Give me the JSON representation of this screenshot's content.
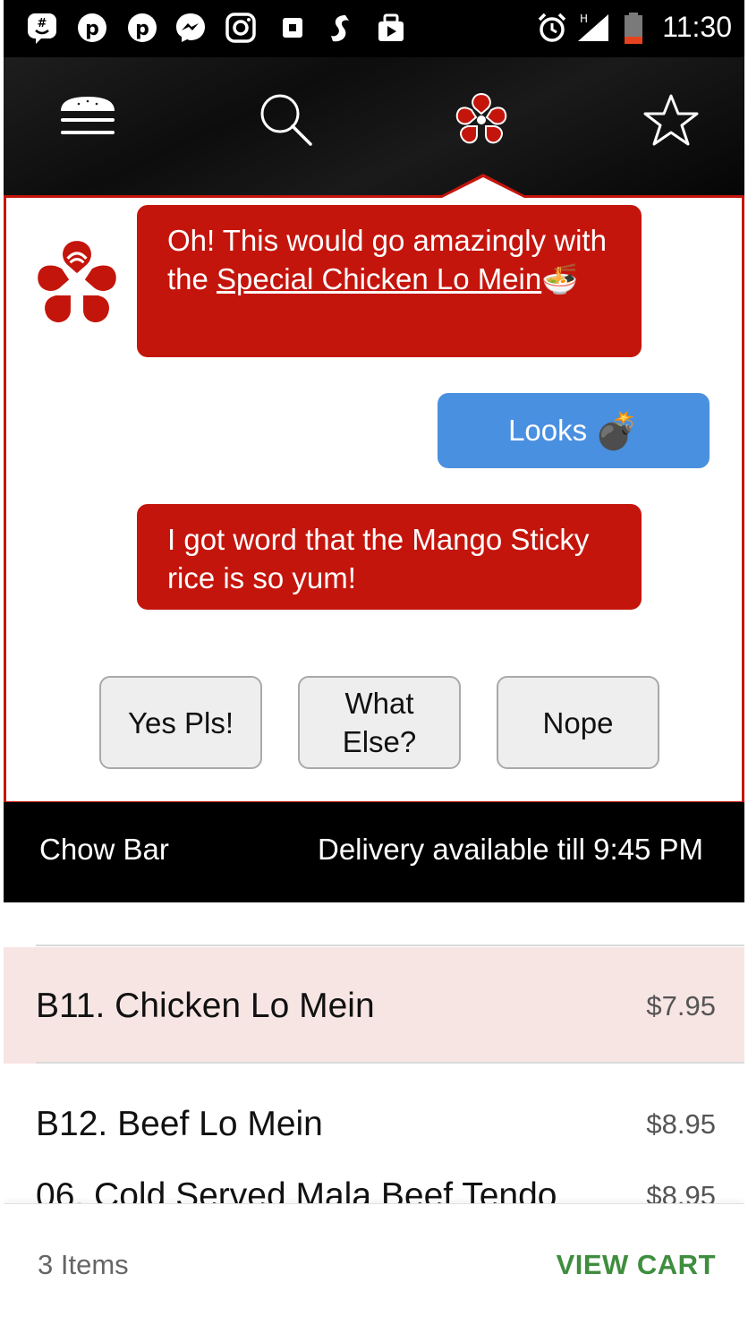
{
  "status_bar": {
    "time": "11:30",
    "network": "H",
    "left_icons": [
      "groupme-icon",
      "pinterest-icon",
      "pinterest-icon",
      "messenger-icon",
      "instagram-icon",
      "square-app-icon",
      "shazam-icon",
      "youtube-icon"
    ]
  },
  "nav": {
    "icons": [
      "menu-burger-icon",
      "search-icon",
      "chowbot-logo-icon",
      "star-icon"
    ]
  },
  "chat": {
    "messages": [
      {
        "from": "bot",
        "text_before": "Oh! This would go amazingly with the ",
        "link": "Special Chicken Lo Mein",
        "emoji": "🍜"
      },
      {
        "from": "user",
        "text": "Looks",
        "emoji": "💣"
      },
      {
        "from": "bot",
        "text": "I got word that the Mango Sticky rice is so yum!"
      }
    ],
    "choices": [
      "Yes Pls!",
      "What Else?",
      "Nope"
    ]
  },
  "restaurant": {
    "name": "Chow Bar",
    "delivery": "Delivery available till 9:45 PM"
  },
  "menu": {
    "items": [
      {
        "name": "B11. Chicken Lo Mein",
        "price": "$7.95",
        "highlighted": true
      },
      {
        "name": "B12. Beef Lo Mein",
        "price": "$8.95",
        "highlighted": false
      },
      {
        "name": "06. Cold Served Mala Beef Tendo",
        "price": "$8.95",
        "highlighted": false
      }
    ]
  },
  "cart": {
    "count_label": "3 Items",
    "action_label": "VIEW CART"
  },
  "colors": {
    "brand_red": "#c4150c",
    "user_blue": "#4a90e0",
    "highlight_row": "#f7e5e4",
    "cart_green": "#3f8d3f"
  }
}
